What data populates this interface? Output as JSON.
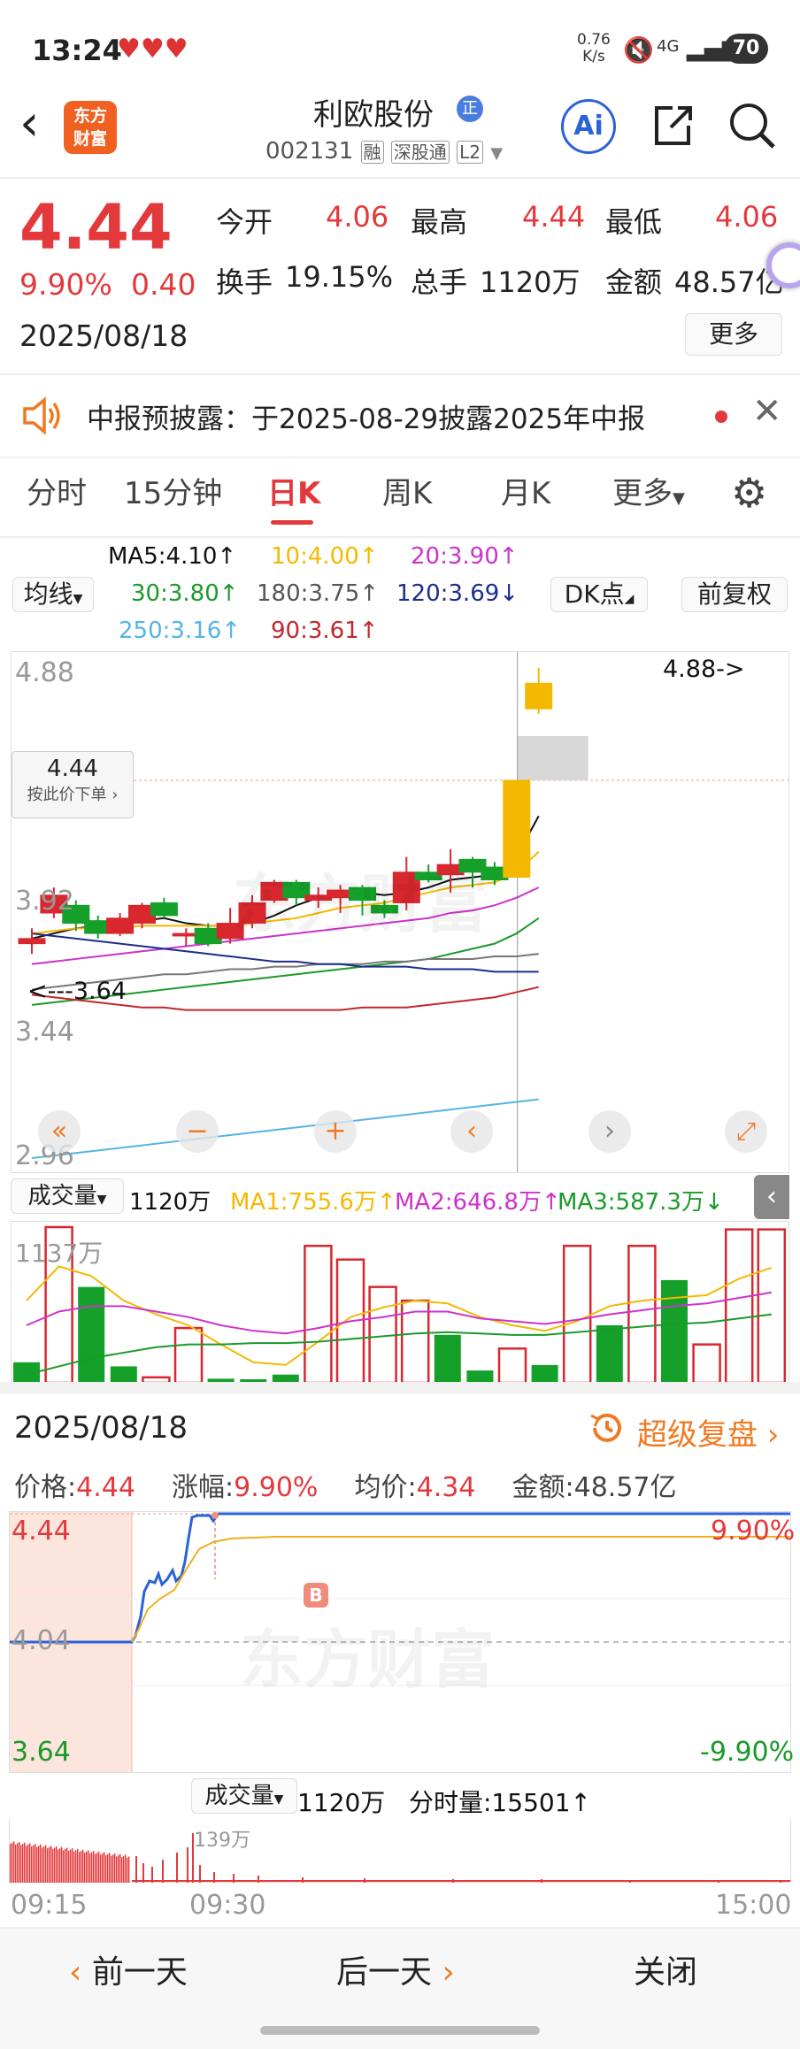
{
  "status_bar": {
    "time": "13:24",
    "net_speed_top": "0.76",
    "net_speed_bottom": "K/s",
    "signal": "4G",
    "battery": "70"
  },
  "header": {
    "logo_line1": "东方",
    "logo_line2": "财富",
    "stock_name": "利欧股份",
    "name_badge": "正",
    "stock_code": "002131",
    "tag1": "融",
    "tag2": "深股通",
    "tag3": "L2",
    "ai_label": "Ai"
  },
  "quote": {
    "price": "4.44",
    "change_pct": "9.90%",
    "change": "0.40",
    "date": "2025/08/18",
    "open_label": "今开",
    "open": "4.06",
    "high_label": "最高",
    "high": "4.44",
    "low_label": "最低",
    "low": "4.06",
    "turnover_label": "换手",
    "turnover": "19.15%",
    "volume_label": "总手",
    "volume": "1120万",
    "amount_label": "金额",
    "amount": "48.57亿",
    "more_button": "更多"
  },
  "notice": {
    "text": "中报预披露：于2025-08-29披露2025年中报"
  },
  "tabs": [
    {
      "label": "分时"
    },
    {
      "label": "15分钟"
    },
    {
      "label": "日K"
    },
    {
      "label": "周K"
    },
    {
      "label": "月K"
    },
    {
      "label": "更多"
    }
  ],
  "ma_bar": {
    "type_label": "均线",
    "ma5": "MA5:4.10↑",
    "ma10": "10:4.00↑",
    "ma20": "20:3.90↑",
    "ma30": "30:3.80↑",
    "ma180": "180:3.75↑",
    "ma120": "120:3.69↓",
    "ma250": "250:3.16↑",
    "ma90": "90:3.61↑",
    "dk_label": "DK点",
    "adjust_label": "前复权"
  },
  "kline": {
    "y_top": "4.88",
    "y_mid": "3.92",
    "y_low": "3.44",
    "y_bottom": "2.96",
    "current_price_tag": "4.44",
    "order_hint": "按此价下单",
    "max_marker": "4.88->",
    "min_marker": "<---3.64",
    "watermark": "东方财富",
    "ylim": [
      2.96,
      4.88
    ],
    "candles": [
      {
        "o": 3.8,
        "c": 3.82,
        "h": 3.86,
        "l": 3.76
      },
      {
        "o": 3.92,
        "c": 3.99,
        "h": 4.02,
        "l": 3.9
      },
      {
        "o": 3.95,
        "c": 3.88,
        "h": 3.97,
        "l": 3.85
      },
      {
        "o": 3.89,
        "c": 3.84,
        "h": 3.91,
        "l": 3.82
      },
      {
        "o": 3.84,
        "c": 3.9,
        "h": 3.92,
        "l": 3.83
      },
      {
        "o": 3.88,
        "c": 3.95,
        "h": 3.96,
        "l": 3.86
      },
      {
        "o": 3.96,
        "c": 3.91,
        "h": 3.98,
        "l": 3.9
      },
      {
        "o": 3.83,
        "c": 3.84,
        "h": 3.86,
        "l": 3.79
      },
      {
        "o": 3.86,
        "c": 3.8,
        "h": 3.88,
        "l": 3.79
      },
      {
        "o": 3.82,
        "c": 3.88,
        "h": 3.94,
        "l": 3.8
      },
      {
        "o": 3.88,
        "c": 3.96,
        "h": 3.99,
        "l": 3.86
      },
      {
        "o": 3.97,
        "c": 4.04,
        "h": 4.05,
        "l": 3.96
      },
      {
        "o": 4.04,
        "c": 3.98,
        "h": 4.05,
        "l": 3.95
      },
      {
        "o": 3.97,
        "c": 3.99,
        "h": 4.02,
        "l": 3.94
      },
      {
        "o": 3.98,
        "c": 4.01,
        "h": 4.03,
        "l": 3.92
      },
      {
        "o": 4.02,
        "c": 3.97,
        "h": 4.03,
        "l": 3.91
      },
      {
        "o": 3.95,
        "c": 3.92,
        "h": 3.97,
        "l": 3.9
      },
      {
        "o": 3.96,
        "c": 4.08,
        "h": 4.14,
        "l": 3.93
      },
      {
        "o": 4.08,
        "c": 4.05,
        "h": 4.11,
        "l": 4.04
      },
      {
        "o": 4.07,
        "c": 4.11,
        "h": 4.17,
        "l": 4.0
      },
      {
        "o": 4.13,
        "c": 4.08,
        "h": 4.14,
        "l": 4.02
      },
      {
        "o": 4.1,
        "c": 4.05,
        "h": 4.12,
        "l": 4.03
      },
      {
        "o": 4.06,
        "c": 4.44,
        "h": 4.44,
        "l": 4.06
      },
      {
        "o": 4.72,
        "c": 4.82,
        "h": 4.88,
        "l": 4.7
      }
    ],
    "ma_lines": [
      {
        "name": "MA5",
        "color": "#111111",
        "values": [
          3.82,
          3.84,
          3.86,
          3.87,
          3.88,
          3.89,
          3.9,
          3.88,
          3.87,
          3.87,
          3.88,
          3.91,
          3.95,
          3.98,
          4.0,
          4.0,
          3.99,
          4.0,
          4.02,
          4.05,
          4.06,
          4.07,
          4.14,
          4.3
        ]
      },
      {
        "name": "MA10",
        "color": "#f5b800",
        "values": [
          3.84,
          3.85,
          3.86,
          3.86,
          3.86,
          3.87,
          3.87,
          3.87,
          3.87,
          3.87,
          3.88,
          3.89,
          3.9,
          3.92,
          3.94,
          3.95,
          3.96,
          3.98,
          4.0,
          4.02,
          4.03,
          4.04,
          4.08,
          4.16
        ]
      },
      {
        "name": "MA20",
        "color": "#cc33cc",
        "values": [
          3.72,
          3.73,
          3.74,
          3.75,
          3.76,
          3.77,
          3.78,
          3.79,
          3.8,
          3.81,
          3.82,
          3.83,
          3.84,
          3.85,
          3.86,
          3.87,
          3.88,
          3.89,
          3.9,
          3.92,
          3.93,
          3.95,
          3.98,
          4.02
        ]
      },
      {
        "name": "MA30",
        "color": "#1a9a2a",
        "values": [
          3.56,
          3.57,
          3.58,
          3.59,
          3.6,
          3.61,
          3.62,
          3.63,
          3.64,
          3.65,
          3.66,
          3.67,
          3.68,
          3.69,
          3.7,
          3.71,
          3.72,
          3.73,
          3.74,
          3.76,
          3.78,
          3.8,
          3.84,
          3.9
        ]
      },
      {
        "name": "MA180",
        "color": "#777777",
        "values": [
          3.62,
          3.63,
          3.64,
          3.65,
          3.66,
          3.67,
          3.68,
          3.68,
          3.69,
          3.7,
          3.7,
          3.71,
          3.71,
          3.72,
          3.72,
          3.72,
          3.73,
          3.73,
          3.74,
          3.74,
          3.74,
          3.75,
          3.75,
          3.76
        ]
      },
      {
        "name": "MA120",
        "color": "#1a2e8a",
        "values": [
          3.84,
          3.83,
          3.82,
          3.81,
          3.8,
          3.79,
          3.78,
          3.77,
          3.76,
          3.75,
          3.74,
          3.73,
          3.73,
          3.72,
          3.72,
          3.71,
          3.71,
          3.71,
          3.7,
          3.7,
          3.7,
          3.69,
          3.69,
          3.69
        ]
      },
      {
        "name": "MA250",
        "color": "#55b4e6",
        "values": [
          2.96,
          2.97,
          2.98,
          2.99,
          3.0,
          3.01,
          3.02,
          3.03,
          3.04,
          3.05,
          3.06,
          3.07,
          3.08,
          3.09,
          3.1,
          3.11,
          3.12,
          3.13,
          3.14,
          3.15,
          3.16,
          3.17,
          3.18,
          3.19
        ]
      },
      {
        "name": "MA90",
        "color": "#c0282d",
        "values": [
          3.6,
          3.59,
          3.58,
          3.57,
          3.56,
          3.55,
          3.55,
          3.54,
          3.54,
          3.54,
          3.54,
          3.54,
          3.54,
          3.54,
          3.54,
          3.55,
          3.55,
          3.55,
          3.56,
          3.57,
          3.58,
          3.59,
          3.61,
          3.63
        ]
      }
    ]
  },
  "volume": {
    "label": "成交量",
    "total": "1120万",
    "ma1": "MA1:755.6万↑",
    "ma2": "MA2:646.8万↑",
    "ma3": "MA3:587.3万↓",
    "y_top": "1137万",
    "bars": [
      {
        "v": 150,
        "up": false
      },
      {
        "v": 1137,
        "up": true
      },
      {
        "v": 700,
        "up": false
      },
      {
        "v": 120,
        "up": false
      },
      {
        "v": 40,
        "up": true
      },
      {
        "v": 400,
        "up": true
      },
      {
        "v": 30,
        "up": false
      },
      {
        "v": 20,
        "up": false
      },
      {
        "v": 60,
        "up": false
      },
      {
        "v": 1000,
        "up": true
      },
      {
        "v": 900,
        "up": true
      },
      {
        "v": 700,
        "up": true
      },
      {
        "v": 600,
        "up": true
      },
      {
        "v": 350,
        "up": false
      },
      {
        "v": 90,
        "up": false
      },
      {
        "v": 250,
        "up": true
      },
      {
        "v": 130,
        "up": false
      },
      {
        "v": 1000,
        "up": true
      },
      {
        "v": 420,
        "up": false
      },
      {
        "v": 1000,
        "up": true
      },
      {
        "v": 750,
        "up": false
      },
      {
        "v": 280,
        "up": true
      },
      {
        "v": 1120,
        "up": true
      },
      {
        "v": 1120,
        "up": true
      }
    ]
  },
  "intraday": {
    "date": "2025/08/18",
    "replay_label": "超级复盘",
    "price_label": "价格:",
    "price": "4.44",
    "change_label": "涨幅:",
    "change": "9.90%",
    "avg_label": "均价:",
    "avg": "4.34",
    "amount_label": "金额:",
    "amount": "48.57亿",
    "y_top": "4.44",
    "y_mid": "4.04",
    "y_bottom": "3.64",
    "pct_top": "9.90%",
    "pct_bottom": "-9.90%",
    "b_marker": "B",
    "vol_label": "成交量",
    "vol_total": "1120万",
    "tick_vol": "分时量:15501↑",
    "vol_peak": "139万",
    "time_start": "09:15",
    "time_open": "09:30",
    "time_end": "15:00"
  },
  "bottom": {
    "prev": "前一天",
    "next": "后一天",
    "close": "关闭"
  }
}
